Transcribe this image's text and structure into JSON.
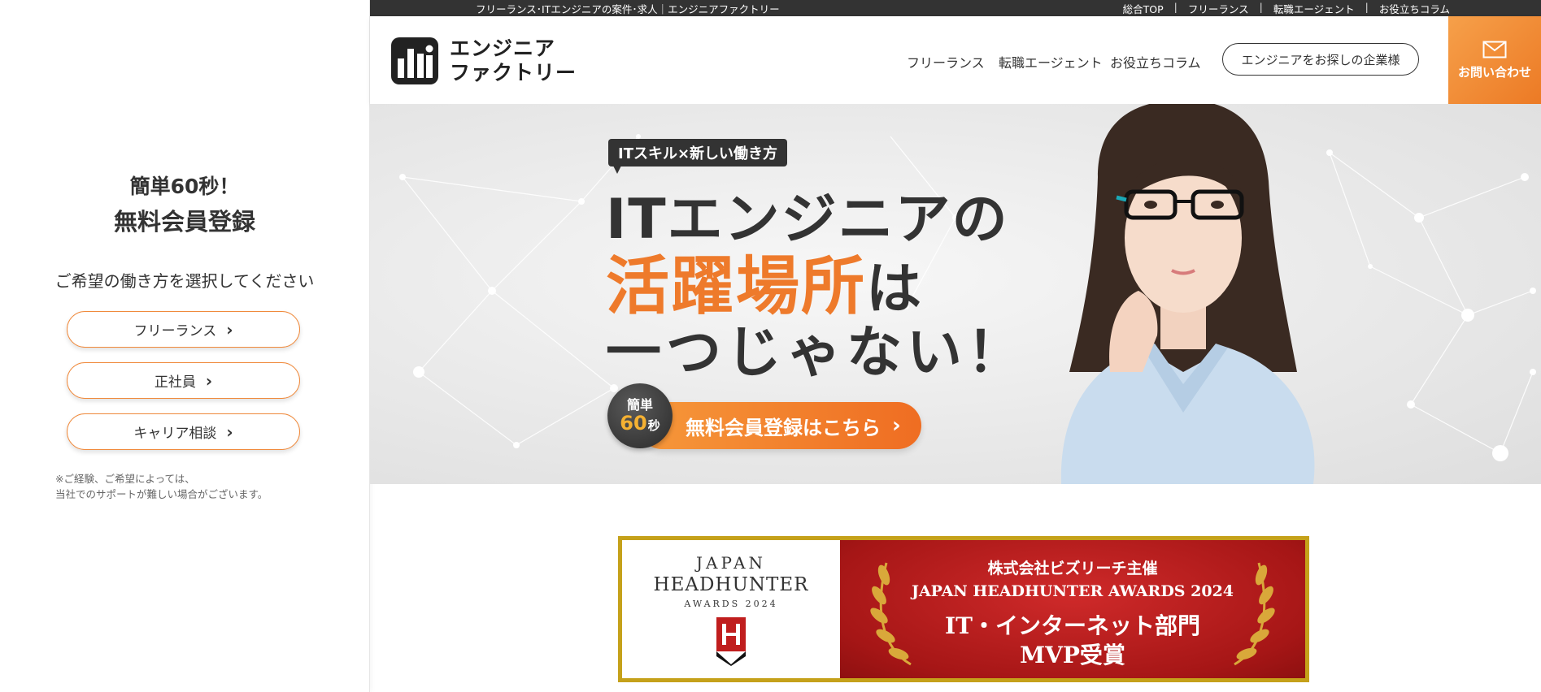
{
  "left_panel": {
    "title_line1": "簡単60秒！",
    "title_line2": "無料会員登録",
    "instruction": "ご希望の働き方を選択してください",
    "buttons": [
      {
        "label": "フリーランス"
      },
      {
        "label": "正社員"
      },
      {
        "label": "キャリア相談"
      }
    ],
    "note_line1": "※ご経験、ご希望によっては、",
    "note_line2": "当社でのサポートが難しい場合がございます。"
  },
  "topbar": {
    "title": "フリーランス･ITエンジニアの案件･求人｜エンジニアファクトリー",
    "links": [
      "総合TOP",
      "フリーランス",
      "転職エージェント",
      "お役立ちコラム"
    ],
    "separator": "|"
  },
  "header": {
    "logo_line1": "エンジニア",
    "logo_line2": "ファクトリー",
    "nav": [
      "フリーランス",
      "転職エージェント",
      "お役立ちコラム"
    ],
    "enterprise_button": "エンジニアをお探しの企業様",
    "contact_button": "お問い合わせ"
  },
  "hero": {
    "tag": "ITスキル×新しい働き方",
    "line1": "ITエンジニアの",
    "line2_accent": "活躍場所",
    "line2_plain": "は",
    "line3": "一つじゃない！",
    "badge_top": "簡単",
    "badge_number": "60",
    "badge_unit": "秒",
    "cta_label": "無料会員登録はこちら",
    "chevron": "›"
  },
  "award": {
    "left_line1": "JAPAN",
    "left_line2": "HEADHUNTER",
    "left_line3": "AWARDS 2024",
    "right_line1": "株式会社ビズリーチ主催",
    "right_line2": "JAPAN HEADHUNTER AWARDS 2024",
    "right_line3": "IT・インターネット部門",
    "right_line4": "MVP受賞"
  },
  "colors": {
    "accent_orange": "#ee7a2b",
    "topbar_bg": "#333333",
    "award_red": "#b51c1c",
    "award_gold": "#c5a11a"
  },
  "icons": [
    "envelope-icon",
    "chevron-right-icon",
    "engineer-factory-logo",
    "laurel-icon",
    "award-emblem-icon"
  ]
}
